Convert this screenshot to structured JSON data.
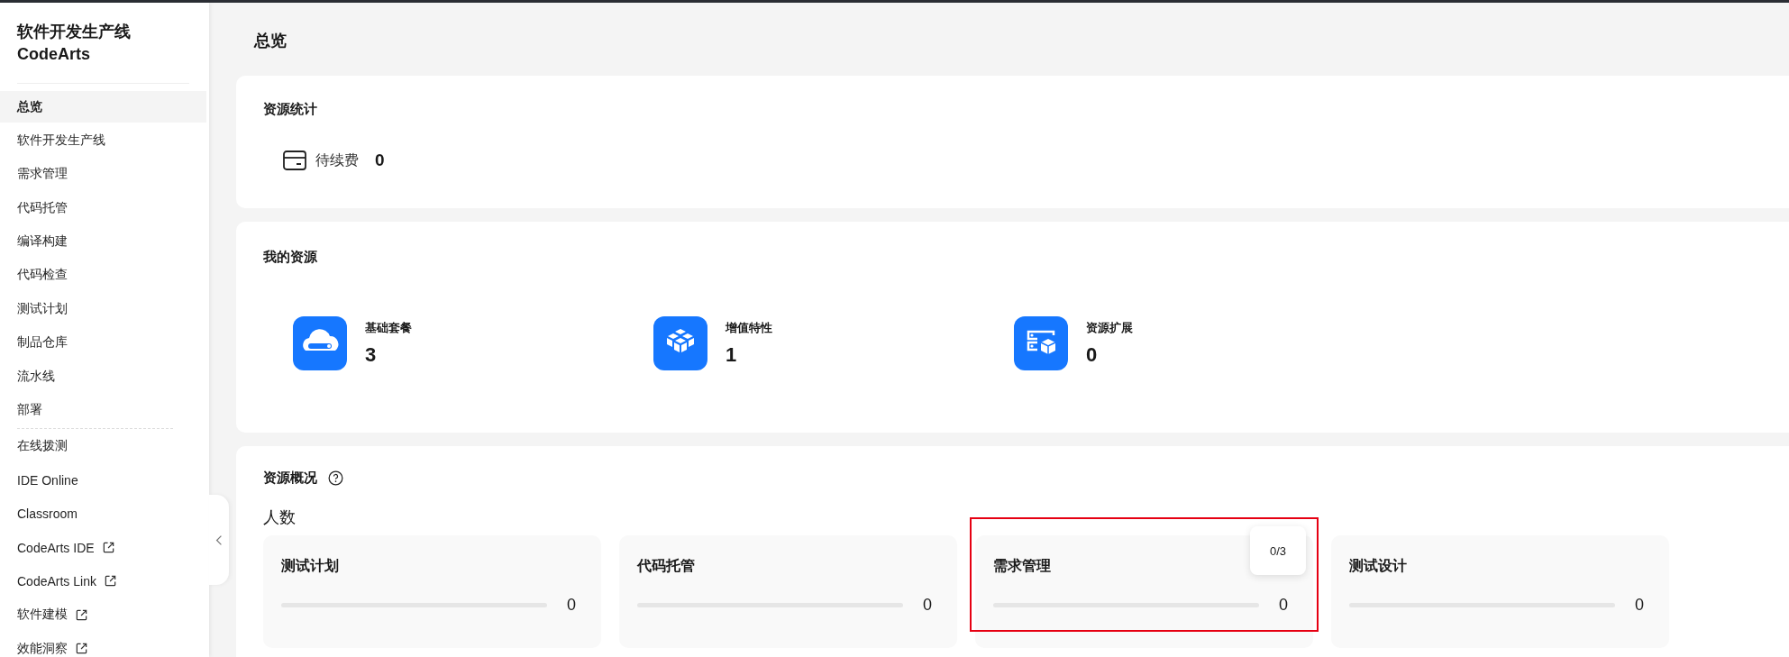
{
  "sidebar": {
    "title": "软件开发生产线",
    "subtitle": "CodeArts",
    "groups": [
      [
        {
          "label": "总览",
          "selected": true,
          "external": false
        },
        {
          "label": "软件开发生产线",
          "selected": false,
          "external": false
        },
        {
          "label": "需求管理",
          "selected": false,
          "external": false
        },
        {
          "label": "代码托管",
          "selected": false,
          "external": false
        },
        {
          "label": "编译构建",
          "selected": false,
          "external": false
        },
        {
          "label": "代码检查",
          "selected": false,
          "external": false
        },
        {
          "label": "测试计划",
          "selected": false,
          "external": false
        },
        {
          "label": "制品仓库",
          "selected": false,
          "external": false
        },
        {
          "label": "流水线",
          "selected": false,
          "external": false
        },
        {
          "label": "部署",
          "selected": false,
          "external": false
        }
      ],
      [
        {
          "label": "在线拨测",
          "selected": false,
          "external": false
        },
        {
          "label": "IDE Online",
          "selected": false,
          "external": false
        },
        {
          "label": "Classroom",
          "selected": false,
          "external": false
        },
        {
          "label": "CodeArts IDE",
          "selected": false,
          "external": true
        },
        {
          "label": "CodeArts Link",
          "selected": false,
          "external": true
        },
        {
          "label": "软件建模",
          "selected": false,
          "external": true
        },
        {
          "label": "效能洞察",
          "selected": false,
          "external": true
        }
      ]
    ]
  },
  "page": {
    "title": "总览"
  },
  "resource_stats": {
    "title": "资源统计",
    "items": [
      {
        "label": "待续费",
        "value": "0"
      }
    ]
  },
  "my_resources": {
    "title": "我的资源",
    "items": [
      {
        "kind": "package",
        "label": "基础套餐",
        "value": "3"
      },
      {
        "kind": "feature",
        "label": "增值特性",
        "value": "1"
      },
      {
        "kind": "extension",
        "label": "资源扩展",
        "value": "0"
      }
    ]
  },
  "overview": {
    "title": "资源概况",
    "subtitle": "人数",
    "items": [
      {
        "label": "测试计划",
        "level": 0,
        "value": "0",
        "highlighted": false
      },
      {
        "label": "代码托管",
        "level": 0,
        "value": "0",
        "highlighted": false
      },
      {
        "label": "需求管理",
        "level": 0,
        "value": "0",
        "highlighted": true,
        "tooltip": "0/3"
      },
      {
        "label": "测试设计",
        "level": 0,
        "value": "0",
        "highlighted": false
      }
    ]
  }
}
